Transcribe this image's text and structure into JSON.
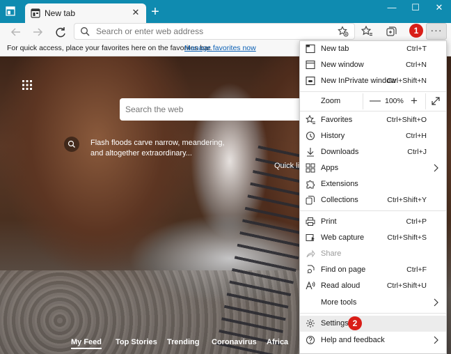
{
  "browser": {
    "tab_title": "New tab",
    "address_placeholder": "Search or enter web address"
  },
  "favorites_bar": {
    "text": "For quick access, place your favorites here on the favorites bar.",
    "link": "Manage favorites now"
  },
  "page": {
    "search_placeholder": "Search the web",
    "fact": "Flash floods carve narrow, meandering, and altogether extraordinary...",
    "quick_links": "Quick lin",
    "feed": [
      "My Feed",
      "Top Stories",
      "Trending",
      "Coronavirus",
      "Africa"
    ]
  },
  "markers": {
    "one": "1",
    "two": "2"
  },
  "menu": {
    "new_tab": {
      "label": "New tab",
      "shortcut": "Ctrl+T"
    },
    "new_window": {
      "label": "New window",
      "shortcut": "Ctrl+N"
    },
    "inprivate": {
      "label": "New InPrivate window",
      "shortcut": "Ctrl+Shift+N"
    },
    "zoom": {
      "label": "Zoom",
      "minus": "—",
      "value": "100%",
      "plus": "+"
    },
    "favorites": {
      "label": "Favorites",
      "shortcut": "Ctrl+Shift+O"
    },
    "history": {
      "label": "History",
      "shortcut": "Ctrl+H"
    },
    "downloads": {
      "label": "Downloads",
      "shortcut": "Ctrl+J"
    },
    "apps": {
      "label": "Apps"
    },
    "extensions": {
      "label": "Extensions"
    },
    "collections": {
      "label": "Collections",
      "shortcut": "Ctrl+Shift+Y"
    },
    "print": {
      "label": "Print",
      "shortcut": "Ctrl+P"
    },
    "web_capture": {
      "label": "Web capture",
      "shortcut": "Ctrl+Shift+S"
    },
    "share": {
      "label": "Share"
    },
    "find": {
      "label": "Find on page",
      "shortcut": "Ctrl+F"
    },
    "read_aloud": {
      "label": "Read aloud",
      "shortcut": "Ctrl+Shift+U"
    },
    "more_tools": {
      "label": "More tools"
    },
    "settings": {
      "label": "Settings"
    },
    "help": {
      "label": "Help and feedback"
    }
  },
  "colors": {
    "titlebar": "#0f8bb0",
    "marker": "#d91e18",
    "link": "#0a5fb4"
  }
}
